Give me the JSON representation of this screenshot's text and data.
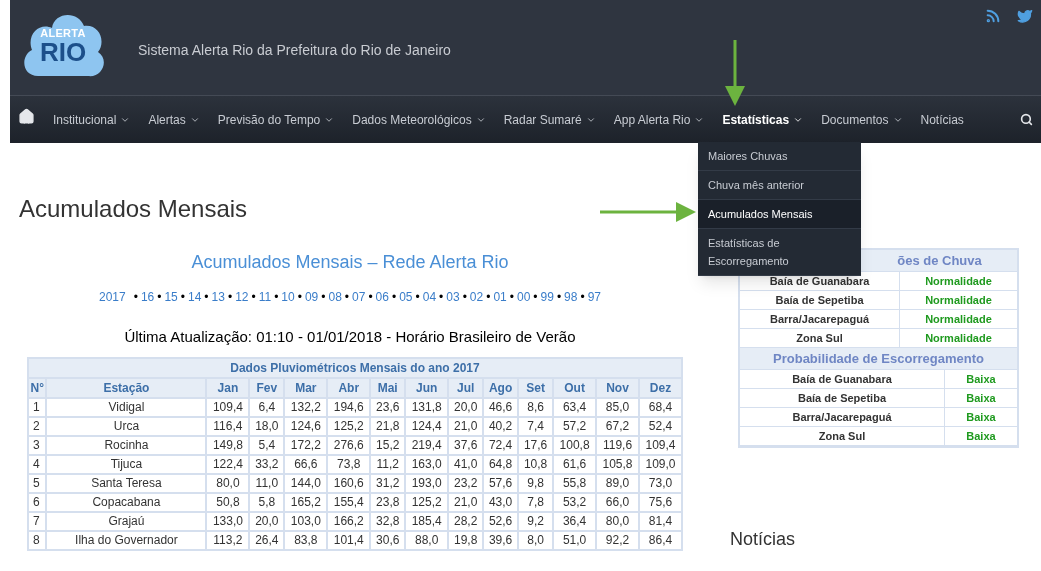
{
  "header": {
    "logo_lines": [
      "ALERTA",
      "RIO"
    ],
    "title": "Sistema Alerta Rio da Prefeitura do Rio de Janeiro"
  },
  "nav": {
    "items": [
      {
        "label": "Institucional",
        "has_menu": true,
        "selected": false
      },
      {
        "label": "Alertas",
        "has_menu": true,
        "selected": false
      },
      {
        "label": "Previsão do Tempo",
        "has_menu": true,
        "selected": false
      },
      {
        "label": "Dados Meteorológicos",
        "has_menu": true,
        "selected": false
      },
      {
        "label": "Radar Sumaré",
        "has_menu": true,
        "selected": false
      },
      {
        "label": "App Alerta Rio",
        "has_menu": true,
        "selected": false
      },
      {
        "label": "Estatísticas",
        "has_menu": true,
        "selected": true
      },
      {
        "label": "Documentos",
        "has_menu": true,
        "selected": false
      },
      {
        "label": "Notícias",
        "has_menu": false,
        "selected": false
      }
    ]
  },
  "dropdown": {
    "items": [
      {
        "label": "Maiores Chuvas",
        "selected": false
      },
      {
        "label": "Chuva mês anterior",
        "selected": false
      },
      {
        "label": "Acumulados Mensais",
        "selected": true
      },
      {
        "label": "Estatísticas de Escorregamento",
        "selected": false
      }
    ]
  },
  "page_title": "Acumulados Mensais",
  "section_title": "Acumulados Mensais – Rede Alerta Rio",
  "year_links": {
    "separator": "•",
    "items": [
      "2017",
      "16",
      "15",
      "14",
      "13",
      "12",
      "11",
      "10",
      "09",
      "08",
      "07",
      "06",
      "05",
      "04",
      "03",
      "02",
      "01",
      "00",
      "99",
      "98",
      "97"
    ]
  },
  "update_text": "Última Atualização: 01:10 - 01/01/2018 - Horário Brasileiro de Verão",
  "table": {
    "caption": "Dados Pluviométricos Mensais do ano 2017",
    "columns": [
      "N°",
      "Estação",
      "Jan",
      "Fev",
      "Mar",
      "Abr",
      "Mai",
      "Jun",
      "Jul",
      "Ago",
      "Set",
      "Out",
      "Nov",
      "Dez"
    ],
    "rows": [
      [
        "1",
        "Vidigal",
        "109,4",
        "6,4",
        "132,2",
        "194,6",
        "23,6",
        "131,8",
        "20,0",
        "46,6",
        "8,6",
        "63,4",
        "85,0",
        "68,4"
      ],
      [
        "2",
        "Urca",
        "116,4",
        "18,0",
        "124,6",
        "125,2",
        "21,8",
        "124,4",
        "21,0",
        "40,2",
        "7,4",
        "57,2",
        "67,2",
        "52,4"
      ],
      [
        "3",
        "Rocinha",
        "149,8",
        "5,4",
        "172,2",
        "276,6",
        "15,2",
        "219,4",
        "37,6",
        "72,4",
        "17,6",
        "100,8",
        "119,6",
        "109,4"
      ],
      [
        "4",
        "Tijuca",
        "122,4",
        "33,2",
        "66,6",
        "73,8",
        "11,2",
        "163,0",
        "41,0",
        "64,8",
        "10,8",
        "61,6",
        "105,8",
        "109,0"
      ],
      [
        "5",
        "Santa Teresa",
        "80,0",
        "11,0",
        "144,0",
        "160,6",
        "31,2",
        "193,0",
        "23,2",
        "57,6",
        "9,8",
        "55,8",
        "89,0",
        "73,0"
      ],
      [
        "6",
        "Copacabana",
        "50,8",
        "5,8",
        "165,2",
        "155,4",
        "23,8",
        "125,2",
        "21,0",
        "43,0",
        "7,8",
        "53,2",
        "66,0",
        "75,6"
      ],
      [
        "7",
        "Grajaú",
        "133,0",
        "20,0",
        "103,0",
        "166,2",
        "32,8",
        "185,4",
        "28,2",
        "52,6",
        "9,2",
        "36,4",
        "80,0",
        "81,4"
      ],
      [
        "8",
        "Ilha do Governador",
        "113,2",
        "26,4",
        "83,8",
        "101,4",
        "30,6",
        "88,0",
        "19,8",
        "39,6",
        "8,0",
        "51,0",
        "92,2",
        "86,4"
      ]
    ]
  },
  "status_tables": [
    {
      "title": "ões de Chuva",
      "title_covered": true,
      "rows": [
        {
          "region": "Baía de Guanabara",
          "status": "Normalidade"
        },
        {
          "region": "Baía de Sepetiba",
          "status": "Normalidade"
        },
        {
          "region": "Barra/Jacarepaguá",
          "status": "Normalidade"
        },
        {
          "region": "Zona Sul",
          "status": "Normalidade"
        }
      ]
    },
    {
      "title": "Probabilidade de Escorregamento",
      "title_covered": false,
      "rows": [
        {
          "region": "Baía de Guanabara",
          "status": "Baixa"
        },
        {
          "region": "Baía de Sepetiba",
          "status": "Baixa"
        },
        {
          "region": "Barra/Jacarepaguá",
          "status": "Baixa"
        },
        {
          "region": "Zona Sul",
          "status": "Baixa"
        }
      ]
    }
  ],
  "news_heading": "Notícias"
}
